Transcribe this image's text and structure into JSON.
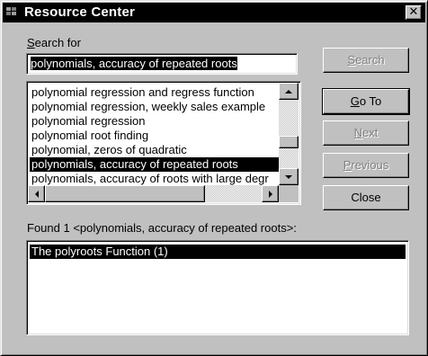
{
  "window": {
    "title": "Resource Center",
    "close_glyph": "✕"
  },
  "search": {
    "label_prefix": "",
    "label_mnemonic": "S",
    "label_rest": "earch for",
    "value": "polynomials, accuracy of repeated roots"
  },
  "topic_list": {
    "items": [
      "polynomial regression and regress function",
      "polynomial regression, weekly sales example",
      "polynomial regression",
      "polynomial root finding",
      "polynomial, zeros of quadratic",
      "polynomials, accuracy of repeated roots",
      "polynomials, accuracy of roots with large degr"
    ],
    "selected_index": 5
  },
  "buttons": {
    "search": {
      "mnemonic": "S",
      "rest": "earch",
      "enabled": false
    },
    "goto": {
      "mnemonic": "G",
      "rest": "o To",
      "enabled": true
    },
    "next": {
      "mnemonic": "N",
      "rest": "ext",
      "enabled": false
    },
    "previous": {
      "mnemonic": "P",
      "rest": "revious",
      "enabled": false
    },
    "close": {
      "label": "Close",
      "enabled": true
    }
  },
  "found": {
    "label": "Found 1  <polynomials, accuracy of repeated roots>:"
  },
  "results": {
    "items": [
      "The polyroots Function  (1)"
    ]
  }
}
